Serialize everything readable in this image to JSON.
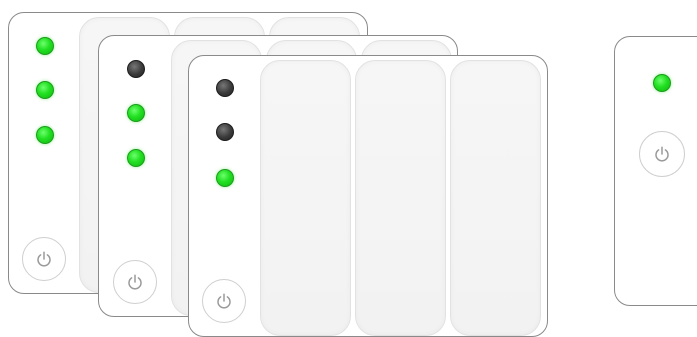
{
  "units": [
    {
      "id": "unit-1",
      "leds": [
        "on",
        "on",
        "on"
      ],
      "bays": 3,
      "power_icon": "power-icon"
    },
    {
      "id": "unit-2",
      "leds": [
        "off",
        "on",
        "on"
      ],
      "bays": 3,
      "power_icon": "power-icon"
    },
    {
      "id": "unit-3",
      "leds": [
        "off",
        "off",
        "on"
      ],
      "bays": 3,
      "power_icon": "power-icon"
    },
    {
      "id": "unit-4",
      "leds": [
        "on"
      ],
      "bays": 0,
      "power_icon": "power-icon"
    }
  ],
  "colors": {
    "led_on": "#22e022",
    "led_off": "#3a3a3a",
    "border": "#8a8a8a",
    "bay": "#f4f4f4"
  }
}
